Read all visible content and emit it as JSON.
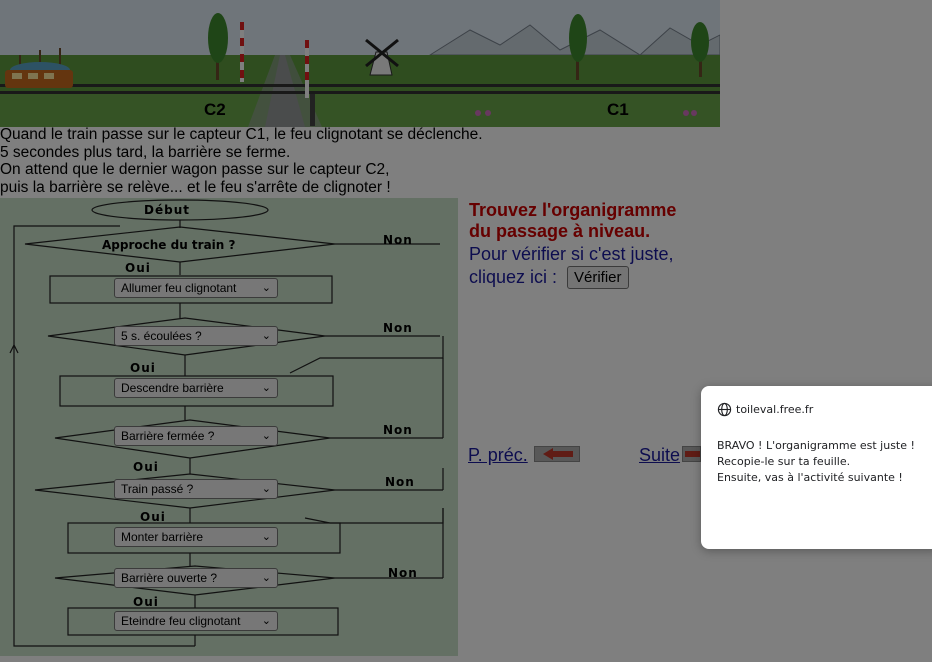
{
  "banner": {
    "sensor_c2": "C2",
    "sensor_c1": "C1"
  },
  "intro": {
    "line1": "Quand le train passe sur le capteur C1, le feu clignotant se déclenche.",
    "line2": "5 secondes plus tard, la barrière se ferme.",
    "line3": "On attend que le dernier wagon passe sur le capteur C2,",
    "line4": "puis la barrière se relève... et le feu s'arrête de clignoter !"
  },
  "flowchart": {
    "start": "Début",
    "approach": "Approche du train ?",
    "yes": "Oui",
    "no": "Non",
    "selects": [
      "Allumer feu clignotant",
      "5 s. écoulées ?",
      "Descendre barrière",
      "Barrière fermée ?",
      "Train passé ?",
      "Monter barrière",
      "Barrière ouverte ?",
      "Eteindre feu clignotant"
    ]
  },
  "instructions": {
    "title_line1": "Trouvez l'organigramme",
    "title_line2": "du passage à niveau.",
    "check_line1": "Pour vérifier si c'est juste,",
    "check_line2": "cliquez ici :",
    "verify_label": "Vérifier"
  },
  "nav": {
    "prev_label": "P. préc.",
    "next_label": "Suite"
  },
  "dialog": {
    "origin": "toileval.free.fr",
    "message_line1": "BRAVO ! L'organigramme est juste !",
    "message_line2": "Recopie-le sur ta feuille.",
    "message_line3": "Ensuite, vas à l'activité suivante !"
  },
  "colors": {
    "title_red": "#cc0000",
    "text_blue": "#1a1a9e",
    "flow_bg": "#c8e0c8"
  }
}
